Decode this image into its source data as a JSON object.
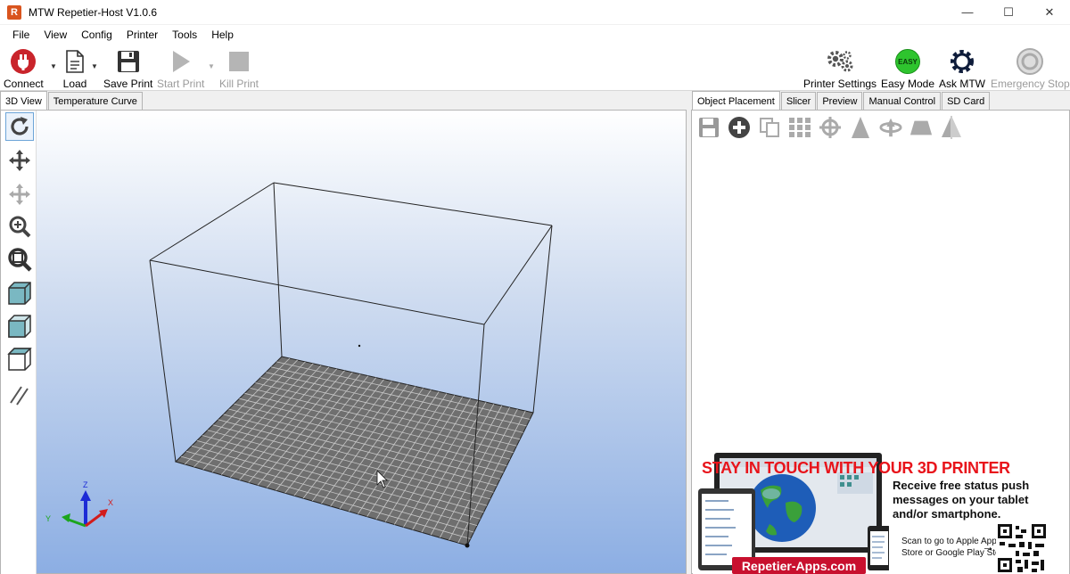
{
  "window": {
    "title": "MTW Repetier-Host V1.0.6",
    "app_icon_letter": "R",
    "minimize": "—",
    "maximize": "☐",
    "close": "✕"
  },
  "menu": [
    "File",
    "View",
    "Config",
    "Printer",
    "Tools",
    "Help"
  ],
  "toolbar": {
    "connect": "Connect",
    "load": "Load",
    "save_print": "Save Print",
    "start_print": "Start Print",
    "kill_print": "Kill Print",
    "printer_settings": "Printer Settings",
    "easy_mode": "Easy Mode",
    "easy_badge": "EASY",
    "ask_mtw": "Ask MTW",
    "emergency_stop": "Emergency Stop"
  },
  "left_tabs": [
    "3D View",
    "Temperature Curve"
  ],
  "right_tabs": [
    "Object Placement",
    "Slicer",
    "Preview",
    "Manual Control",
    "SD Card"
  ],
  "axes": {
    "x": "X",
    "y": "Y",
    "z": "Z"
  },
  "ad": {
    "headline": "STAY IN TOUCH WITH YOUR 3D PRINTER",
    "subtext": "Receive free status push messages on your tablet and/or smartphone.",
    "scan_text": "Scan to go to Apple App Store or Google Play Store",
    "arrow": "→",
    "url": "Repetier-Apps.com"
  },
  "colors": {
    "connect_red": "#c9242b",
    "easy_green": "#2ec42e",
    "ad_red": "#e8141b",
    "viewport_blue": "#8caee3",
    "bed_grey": "#6f6f6f"
  }
}
